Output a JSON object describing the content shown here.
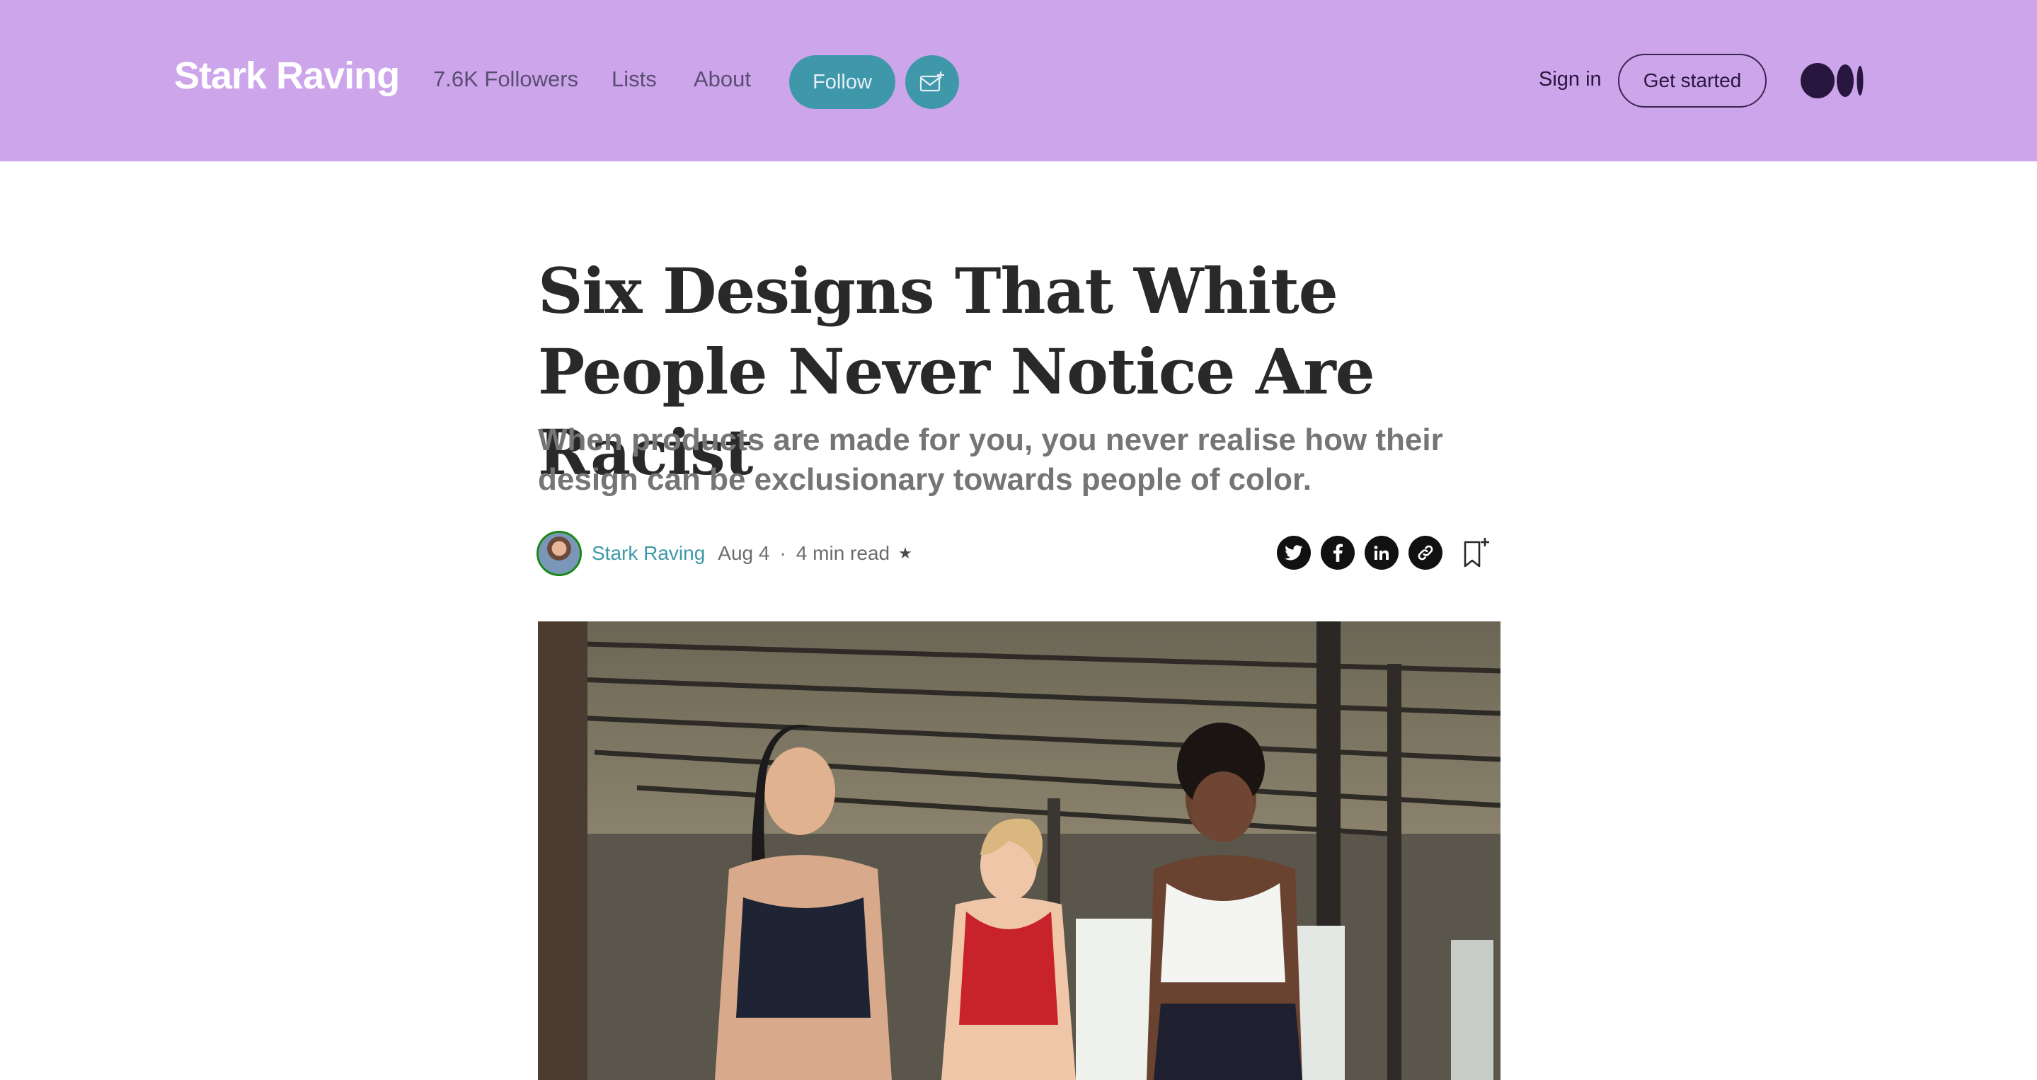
{
  "header": {
    "brand": "Stark Raving",
    "followers": "7.6K Followers",
    "lists": "Lists",
    "about": "About",
    "follow": "Follow",
    "sign_in": "Sign in",
    "get_started": "Get started",
    "colors": {
      "background": "#cda5ea",
      "accent": "#3e98a9",
      "dark": "#29163f"
    }
  },
  "article": {
    "title": "Six Designs That White People Never Notice Are Racist",
    "subtitle": "When products are made for you, you never realise how their design can be exclusionary towards people of color.",
    "author": "Stark Raving",
    "date": "Aug 4",
    "separator": "·",
    "read_time": "4 min read",
    "star": "★"
  },
  "icons": {
    "subscribe": "mail-plus-icon",
    "logo": "medium-logo-icon",
    "share": [
      "twitter-icon",
      "facebook-icon",
      "linkedin-icon",
      "link-icon"
    ],
    "bookmark": "bookmark-add-icon"
  }
}
